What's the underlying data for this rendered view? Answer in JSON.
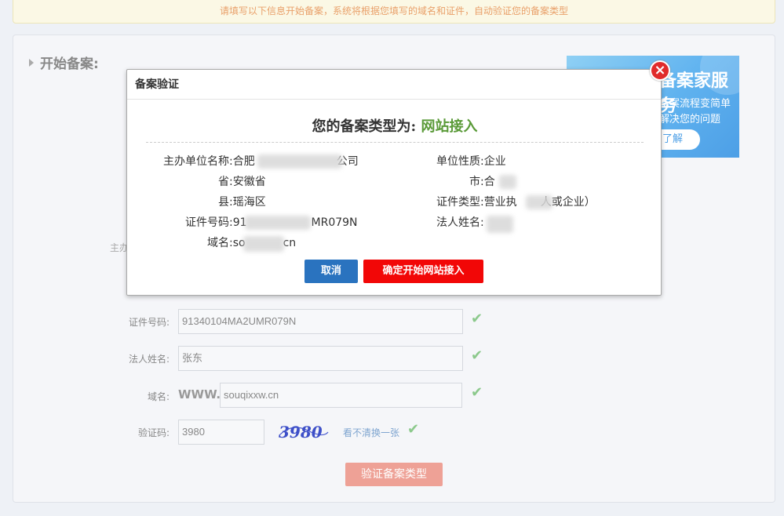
{
  "notice": "请填写以下信息开始备案，系统将根据您填写的域名和证件，自动验证您的备案类型",
  "panel": {
    "title": "开始备案:"
  },
  "banner": {
    "title": "备案家服务",
    "line1": "备案流程变简单",
    "line2": "解决您的问题",
    "button": "了解"
  },
  "form": {
    "owner_label": "主办",
    "id_label": "证件号码:",
    "id_value": "91340104MA2UMR079N",
    "legal_label": "法人姓名:",
    "legal_value": "张东",
    "domain_label": "域名:",
    "domain_prefix": "WWW.",
    "domain_value": "souqixxw.cn",
    "captcha_label": "验证码:",
    "captcha_value": "3980",
    "captcha_image_text": "3980",
    "refresh_link": "看不清换一张",
    "verify_button": "验证备案类型"
  },
  "modal": {
    "header": "备案验证",
    "close_glyph": "×",
    "headline_prefix": "您的备案类型为:",
    "headline_type": "网站接入",
    "left": {
      "org_name": "主办单位名称:合肥",
      "org_name_tail": "公司",
      "province": "省:安徽省",
      "county": "县:瑶海区",
      "id_number": "证件号码:91",
      "id_number_tail": "MR079N",
      "domain": "域名:so",
      "domain_tail": "cn"
    },
    "right": {
      "org_type": "单位性质:企业",
      "city": "市:合",
      "cert_type": "证件类型:营业执",
      "cert_type_tail": "人或企业）",
      "legal_name": "法人姓名:"
    },
    "cancel_button": "取消",
    "confirm_button": "确定开始网站接入"
  },
  "colors": {
    "confirm": "#f20707",
    "cancel": "#2a73bf",
    "type_highlight": "#5a9a38",
    "close": "#e02b2b"
  }
}
